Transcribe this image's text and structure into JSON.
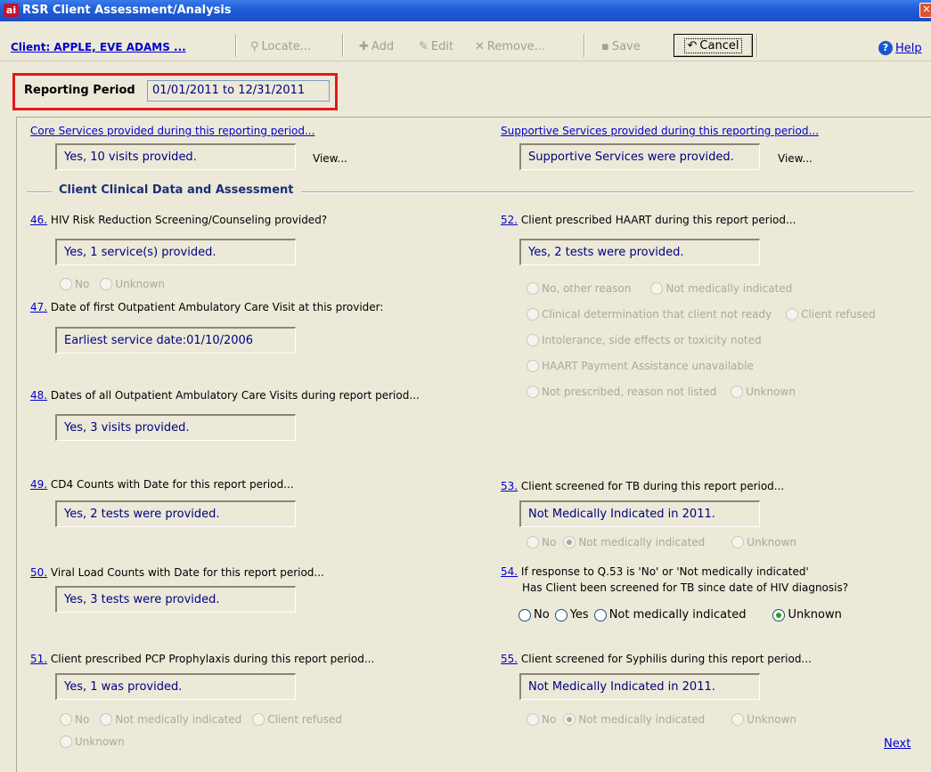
{
  "window": {
    "title": "RSR Client Assessment/Analysis",
    "app_icon": "ai",
    "close_icon": "close-icon"
  },
  "toolbar": {
    "client_label": "Client: APPLE, EVE ADAMS ...",
    "locate": "Locate...",
    "add": "Add",
    "edit": "Edit",
    "remove": "Remove...",
    "save": "Save",
    "cancel": "Cancel",
    "help": "Help"
  },
  "reporting_period": {
    "label": "Reporting Period",
    "value": "01/01/2011 to 12/31/2011"
  },
  "services": {
    "core_link": "Core Services provided during this reporting period...",
    "core_value": "Yes, 10 visits provided.",
    "core_view": "View...",
    "supportive_link": "Supportive Services provided during this reporting period...",
    "supportive_value": "Supportive Services were provided.",
    "supportive_view": "View..."
  },
  "section_title": "Client Clinical Data and Assessment",
  "questions": {
    "q46": {
      "num": "46.",
      "label": "HIV Risk Reduction Screening/Counseling provided?",
      "value": "Yes, 1 service(s) provided.",
      "options": [
        "No",
        "Unknown"
      ]
    },
    "q47": {
      "num": "47.",
      "label": "Date of first Outpatient Ambulatory Care Visit at this provider:",
      "value": "Earliest service date:01/10/2006"
    },
    "q48": {
      "num": "48.",
      "label": "Dates of all Outpatient Ambulatory Care Visits during report period...",
      "value": "Yes, 3 visits provided."
    },
    "q49": {
      "num": "49.",
      "label": "CD4 Counts with Date for this report period...",
      "value": "Yes, 2 tests were provided."
    },
    "q50": {
      "num": "50.",
      "label": "Viral Load Counts with Date for this report period...",
      "value": "Yes, 3 tests were provided."
    },
    "q51": {
      "num": "51.",
      "label": "Client prescribed PCP Prophylaxis during this report period...",
      "value": "Yes, 1 was provided.",
      "options": [
        "No",
        "Not medically indicated",
        "Client refused",
        "Unknown"
      ]
    },
    "q52": {
      "num": "52.",
      "label": "Client prescribed HAART during this report period...",
      "value": "Yes, 2 tests were provided.",
      "options": [
        "No, other reason",
        "Not medically indicated",
        "Clinical determination that client not ready",
        "Client refused",
        "Intolerance, side effects or toxicity noted",
        "HAART Payment Assistance unavailable",
        "Not prescribed, reason not listed",
        "Unknown"
      ]
    },
    "q53": {
      "num": "53.",
      "label": "Client screened for TB during this report period...",
      "value": "Not Medically Indicated in 2011.",
      "options": [
        "No",
        "Not medically indicated",
        "Unknown"
      ],
      "selected": "Not medically indicated"
    },
    "q54": {
      "num": "54.",
      "label_line1": "If response to Q.53 is 'No' or 'Not medically indicated'",
      "label_line2": "Has Client been screened for TB since date of HIV diagnosis?",
      "options": [
        "No",
        "Yes",
        "Not medically indicated",
        "Unknown"
      ],
      "selected": "Unknown"
    },
    "q55": {
      "num": "55.",
      "label": "Client screened for Syphilis during this report period...",
      "value": "Not Medically Indicated in 2011.",
      "options": [
        "No",
        "Not medically indicated",
        "Unknown"
      ],
      "selected": "Not medically indicated"
    }
  },
  "next_label": "Next"
}
